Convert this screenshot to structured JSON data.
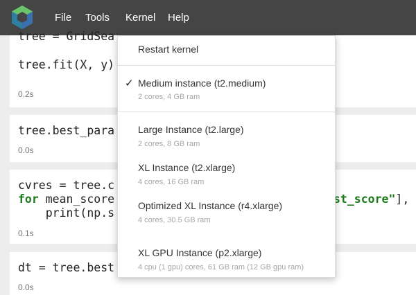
{
  "menubar": {
    "items": [
      "File",
      "Tools",
      "Kernel",
      "Help"
    ]
  },
  "cells": [
    {
      "lines": [
        "tree = GridSea",
        "",
        "tree.fit(X, y)"
      ],
      "time": "0.2s"
    },
    {
      "lines": [
        "tree.best_para"
      ],
      "time": "0.0s"
    },
    {
      "line1": "cvres = tree.c",
      "line2_kw": "for",
      "line2_rest": " mean_score",
      "line2_tail_str": "st_score\"",
      "line2_tail_rest": "],",
      "line3": "    print(np.s",
      "time": "0.1s"
    },
    {
      "lines": [
        "dt = tree.best"
      ],
      "time": "0.0s"
    }
  ],
  "kernel_menu": {
    "restart": "Restart kernel",
    "checkmark": "✓",
    "instances": [
      {
        "label": "Medium instance (t2.medium)",
        "sub": "2 cores, 4 GB ram",
        "selected": true
      },
      {
        "label": "Large Instance (t2.large)",
        "sub": "2 cores, 8 GB ram",
        "selected": false
      },
      {
        "label": "XL Instance (t2.xlarge)",
        "sub": "4 cores, 16 GB ram",
        "selected": false
      },
      {
        "label": "Optimized XL Instance (r4.xlarge)",
        "sub": "4 cores, 30.5 GB ram",
        "selected": false
      },
      {
        "label": "XL GPU Instance (p2.xlarge)",
        "sub": "4 cpu (1 gpu) cores, 61 GB ram (12 GB gpu ram)",
        "selected": false
      }
    ]
  }
}
